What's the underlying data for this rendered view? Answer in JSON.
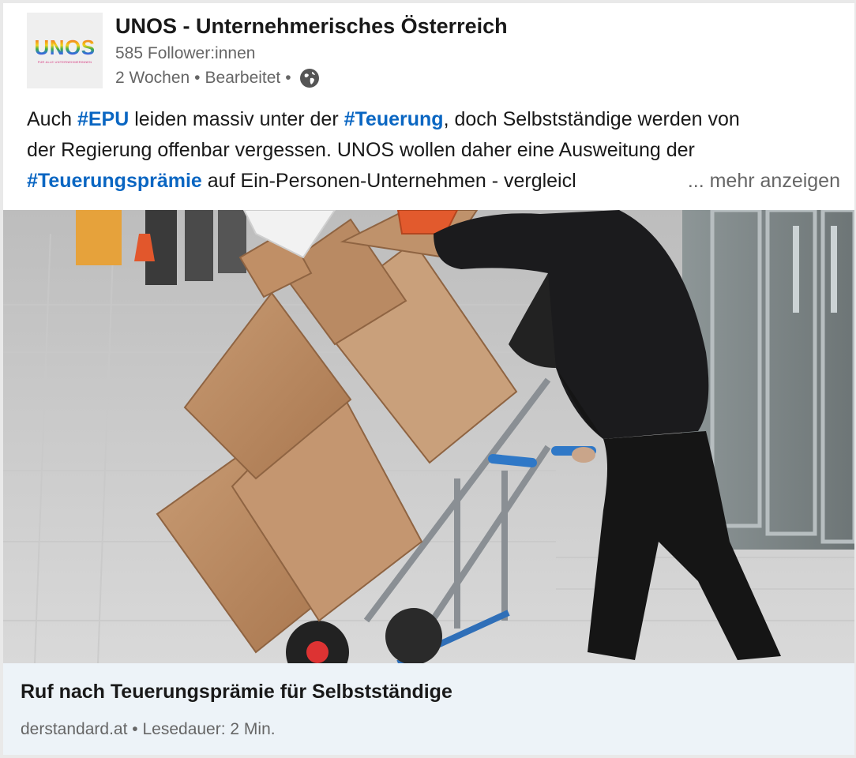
{
  "author": {
    "logo_text": "UNOS",
    "logo_subtext": "FÜR ALLE UNTERNEHMERINNEN",
    "name": "UNOS - Unternehmerisches Österreich",
    "followers": "585 Follower:innen",
    "time": "2 Wochen",
    "edited": "Bearbeitet",
    "separator": "•",
    "visibility_icon": "globe-icon"
  },
  "post": {
    "line1": {
      "t1": "Auch ",
      "h1": "#EPU",
      "t2": " leiden massiv unter der ",
      "h2": "#Teuerung",
      "t3": ", doch Selbstständige werden von"
    },
    "line2": "der Regierung offenbar vergessen. UNOS wollen daher eine Ausweitung der",
    "line3": {
      "h1": "#Teuerungsprämie",
      "t1": " auf Ein-Personen-Unternehmen - vergleicl"
    },
    "more": "... mehr anzeigen",
    "hashtag_color": "#0a66c2"
  },
  "image": {
    "subject": "delivery worker pushing hand truck stacked with cardboard boxes"
  },
  "link_preview": {
    "title": "Ruf nach Teuerungsprämie für Selbstständige",
    "source": "derstandard.at",
    "separator": "•",
    "read_time": "Lesedauer: 2 Min."
  }
}
